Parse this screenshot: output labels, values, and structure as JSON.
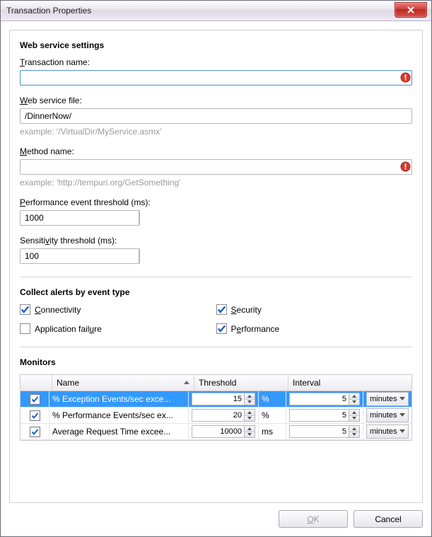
{
  "window": {
    "title": "Transaction Properties"
  },
  "section_web": {
    "heading": "Web service settings"
  },
  "fields": {
    "transaction_name_label_pre": "",
    "transaction_name_label": "Transaction name:",
    "transaction_name_value": "",
    "web_service_file_label": "Web service file:",
    "web_service_file_value": "/DinnerNow/",
    "web_service_file_hint": "example: '/VirtualDir/MyService.asmx'",
    "method_name_label": "Method name:",
    "method_name_value": "",
    "method_name_hint": "example: 'http://tempuri.org/GetSomething'",
    "perf_threshold_label": "Performance event threshold (ms):",
    "perf_threshold_value": "1000",
    "sensitivity_label": "Sensitivity threshold (ms):",
    "sensitivity_value": "100"
  },
  "section_alerts": {
    "heading": "Collect alerts by event type",
    "items": [
      {
        "label": "Connectivity",
        "checked": true
      },
      {
        "label": "Security",
        "checked": true
      },
      {
        "label": "Application failure",
        "checked": false
      },
      {
        "label": "Performance",
        "checked": true
      }
    ]
  },
  "section_monitors": {
    "heading": "Monitors",
    "columns": {
      "name": "Name",
      "threshold": "Threshold",
      "interval": "Interval"
    },
    "rows": [
      {
        "checked": true,
        "name": "% Exception Events/sec exce...",
        "threshold": "15",
        "unit": "%",
        "interval": "5",
        "interval_unit": "minutes",
        "selected": true
      },
      {
        "checked": true,
        "name": "% Performance Events/sec ex...",
        "threshold": "20",
        "unit": "%",
        "interval": "5",
        "interval_unit": "minutes",
        "selected": false
      },
      {
        "checked": true,
        "name": "Average Request Time excee...",
        "threshold": "10000",
        "unit": "ms",
        "interval": "5",
        "interval_unit": "minutes",
        "selected": false
      }
    ]
  },
  "buttons": {
    "ok": "OK",
    "cancel": "Cancel"
  },
  "underlines": {
    "transaction": "T",
    "web": "W",
    "method": "M",
    "performance": "P",
    "sensitivity": "v",
    "connectivity": "C",
    "security": "S",
    "appfailure": "u",
    "perf_cb": "e",
    "ok": "O"
  }
}
